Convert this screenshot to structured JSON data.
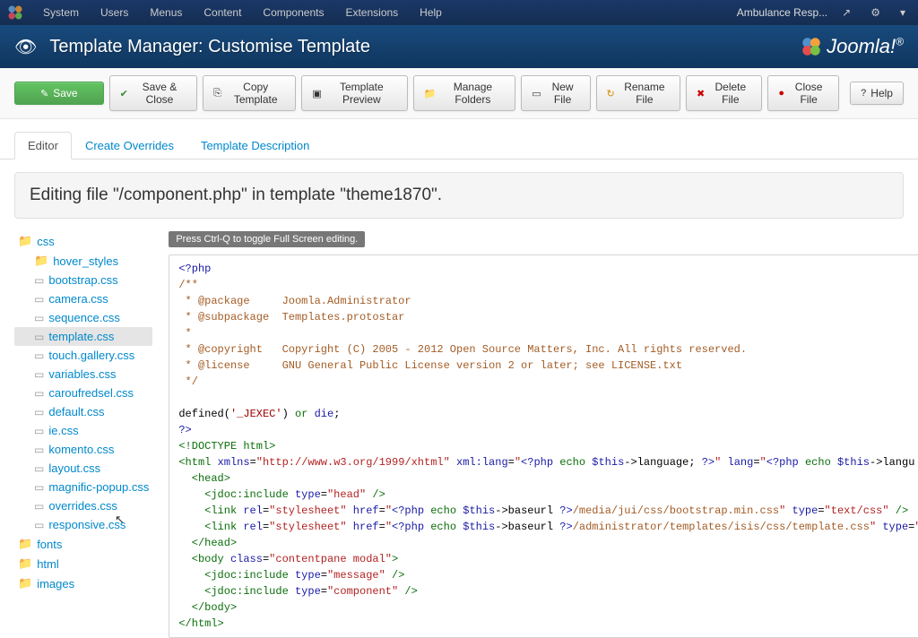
{
  "adminMenu": [
    "System",
    "Users",
    "Menus",
    "Content",
    "Components",
    "Extensions",
    "Help"
  ],
  "adminRight": {
    "site": "Ambulance Resp...",
    "brand": "Joomla!"
  },
  "titleBar": {
    "title": "Template Manager: Customise Template"
  },
  "toolbar": {
    "save": "Save",
    "saveClose": "Save & Close",
    "copyTemplate": "Copy Template",
    "templatePreview": "Template Preview",
    "manageFolders": "Manage Folders",
    "newFile": "New File",
    "renameFile": "Rename File",
    "deleteFile": "Delete File",
    "closeFile": "Close File",
    "help": "Help"
  },
  "tabs": {
    "editor": "Editor",
    "overrides": "Create Overrides",
    "desc": "Template Description"
  },
  "headingText": "Editing file \"/component.php\" in template \"theme1870\".",
  "tree": [
    {
      "type": "folder",
      "depth": 0,
      "name": "css"
    },
    {
      "type": "folder",
      "depth": 1,
      "name": "hover_styles"
    },
    {
      "type": "file",
      "depth": 1,
      "name": "bootstrap.css"
    },
    {
      "type": "file",
      "depth": 1,
      "name": "camera.css"
    },
    {
      "type": "file",
      "depth": 1,
      "name": "sequence.css"
    },
    {
      "type": "file",
      "depth": 1,
      "name": "template.css",
      "selected": true
    },
    {
      "type": "file",
      "depth": 1,
      "name": "touch.gallery.css"
    },
    {
      "type": "file",
      "depth": 1,
      "name": "variables.css"
    },
    {
      "type": "file",
      "depth": 1,
      "name": "caroufredsel.css"
    },
    {
      "type": "file",
      "depth": 1,
      "name": "default.css"
    },
    {
      "type": "file",
      "depth": 1,
      "name": "ie.css"
    },
    {
      "type": "file",
      "depth": 1,
      "name": "komento.css"
    },
    {
      "type": "file",
      "depth": 1,
      "name": "layout.css"
    },
    {
      "type": "file",
      "depth": 1,
      "name": "magnific-popup.css"
    },
    {
      "type": "file",
      "depth": 1,
      "name": "overrides.css"
    },
    {
      "type": "file",
      "depth": 1,
      "name": "responsive.css"
    },
    {
      "type": "folder",
      "depth": 0,
      "name": "fonts"
    },
    {
      "type": "folder",
      "depth": 0,
      "name": "html"
    },
    {
      "type": "folder",
      "depth": 0,
      "name": "images"
    }
  ],
  "editorHint": "Press Ctrl-Q to toggle Full Screen editing.",
  "code": [
    [
      [
        "<?php",
        "c-3"
      ]
    ],
    [
      [
        "/**",
        "c-1"
      ]
    ],
    [
      [
        " * @package     Joomla.Administrator",
        "c-1"
      ]
    ],
    [
      [
        " * @subpackage  Templates.protostar",
        "c-1"
      ]
    ],
    [
      [
        " *",
        "c-1"
      ]
    ],
    [
      [
        " * @copyright   Copyright (C) 2005 - 2012 Open Source Matters, Inc. All rights reserved.",
        "c-1"
      ]
    ],
    [
      [
        " * @license     GNU General Public License version 2 or later; see LICENSE.txt",
        "c-1"
      ]
    ],
    [
      [
        " */",
        "c-1"
      ]
    ],
    [
      [
        "",
        "c-0"
      ]
    ],
    [
      [
        "defined",
        "c-0"
      ],
      [
        "(",
        "c-0"
      ],
      [
        "'_JEXEC'",
        "c-4"
      ],
      [
        ") ",
        "c-0"
      ],
      [
        "or",
        "c-2"
      ],
      [
        " ",
        "c-0"
      ],
      [
        "die",
        "c-3"
      ],
      [
        ";",
        "c-0"
      ]
    ],
    [
      [
        "?>",
        "c-3"
      ]
    ],
    [
      [
        "<!DOCTYPE html>",
        "c-2"
      ]
    ],
    [
      [
        "<html ",
        "c-2"
      ],
      [
        "xmlns",
        "c-3"
      ],
      [
        "=",
        "c-0"
      ],
      [
        "\"http://www.w3.org/1999/xhtml\"",
        "c-6"
      ],
      [
        " xml:lang",
        "c-3"
      ],
      [
        "=",
        "c-0"
      ],
      [
        "\"",
        "c-6"
      ],
      [
        "<?php ",
        "c-3"
      ],
      [
        "echo ",
        "c-2"
      ],
      [
        "$this",
        "c-3"
      ],
      [
        "->",
        "c-0"
      ],
      [
        "language",
        "c-0"
      ],
      [
        "; ",
        "c-0"
      ],
      [
        "?>",
        "c-3"
      ],
      [
        "\"",
        "c-6"
      ],
      [
        " lang",
        "c-3"
      ],
      [
        "=",
        "c-0"
      ],
      [
        "\"",
        "c-6"
      ],
      [
        "<?php ",
        "c-3"
      ],
      [
        "echo ",
        "c-2"
      ],
      [
        "$this",
        "c-3"
      ],
      [
        "->",
        "c-0"
      ],
      [
        "langu",
        "c-0"
      ]
    ],
    [
      [
        "  <head>",
        "c-2"
      ]
    ],
    [
      [
        "    <jdoc:include ",
        "c-2"
      ],
      [
        "type",
        "c-3"
      ],
      [
        "=",
        "c-0"
      ],
      [
        "\"head\"",
        "c-6"
      ],
      [
        " />",
        "c-2"
      ]
    ],
    [
      [
        "    <link ",
        "c-2"
      ],
      [
        "rel",
        "c-3"
      ],
      [
        "=",
        "c-0"
      ],
      [
        "\"stylesheet\"",
        "c-6"
      ],
      [
        " href",
        "c-3"
      ],
      [
        "=",
        "c-0"
      ],
      [
        "\"",
        "c-6"
      ],
      [
        "<?php ",
        "c-3"
      ],
      [
        "echo ",
        "c-2"
      ],
      [
        "$this",
        "c-3"
      ],
      [
        "->",
        "c-0"
      ],
      [
        "baseurl ",
        "c-0"
      ],
      [
        "?>",
        "c-3"
      ],
      [
        "/media/jui/css/bootstrap.min.css",
        "c-1"
      ],
      [
        "\"",
        "c-6"
      ],
      [
        " type",
        "c-3"
      ],
      [
        "=",
        "c-0"
      ],
      [
        "\"text/css\"",
        "c-6"
      ],
      [
        " />",
        "c-2"
      ]
    ],
    [
      [
        "    <link ",
        "c-2"
      ],
      [
        "rel",
        "c-3"
      ],
      [
        "=",
        "c-0"
      ],
      [
        "\"stylesheet\"",
        "c-6"
      ],
      [
        " href",
        "c-3"
      ],
      [
        "=",
        "c-0"
      ],
      [
        "\"",
        "c-6"
      ],
      [
        "<?php ",
        "c-3"
      ],
      [
        "echo ",
        "c-2"
      ],
      [
        "$this",
        "c-3"
      ],
      [
        "->",
        "c-0"
      ],
      [
        "baseurl ",
        "c-0"
      ],
      [
        "?>",
        "c-3"
      ],
      [
        "/administrator/templates/isis/css/template.css",
        "c-1"
      ],
      [
        "\"",
        "c-6"
      ],
      [
        " type",
        "c-3"
      ],
      [
        "=",
        "c-0"
      ],
      [
        "\"",
        "c-6"
      ]
    ],
    [
      [
        "  </head>",
        "c-2"
      ]
    ],
    [
      [
        "  <body ",
        "c-2"
      ],
      [
        "class",
        "c-3"
      ],
      [
        "=",
        "c-0"
      ],
      [
        "\"contentpane modal\"",
        "c-6"
      ],
      [
        ">",
        "c-2"
      ]
    ],
    [
      [
        "    <jdoc:include ",
        "c-2"
      ],
      [
        "type",
        "c-3"
      ],
      [
        "=",
        "c-0"
      ],
      [
        "\"message\"",
        "c-6"
      ],
      [
        " />",
        "c-2"
      ]
    ],
    [
      [
        "    <jdoc:include ",
        "c-2"
      ],
      [
        "type",
        "c-3"
      ],
      [
        "=",
        "c-0"
      ],
      [
        "\"component\"",
        "c-6"
      ],
      [
        " />",
        "c-2"
      ]
    ],
    [
      [
        "  </body>",
        "c-2"
      ]
    ],
    [
      [
        "</html>",
        "c-2"
      ]
    ]
  ]
}
